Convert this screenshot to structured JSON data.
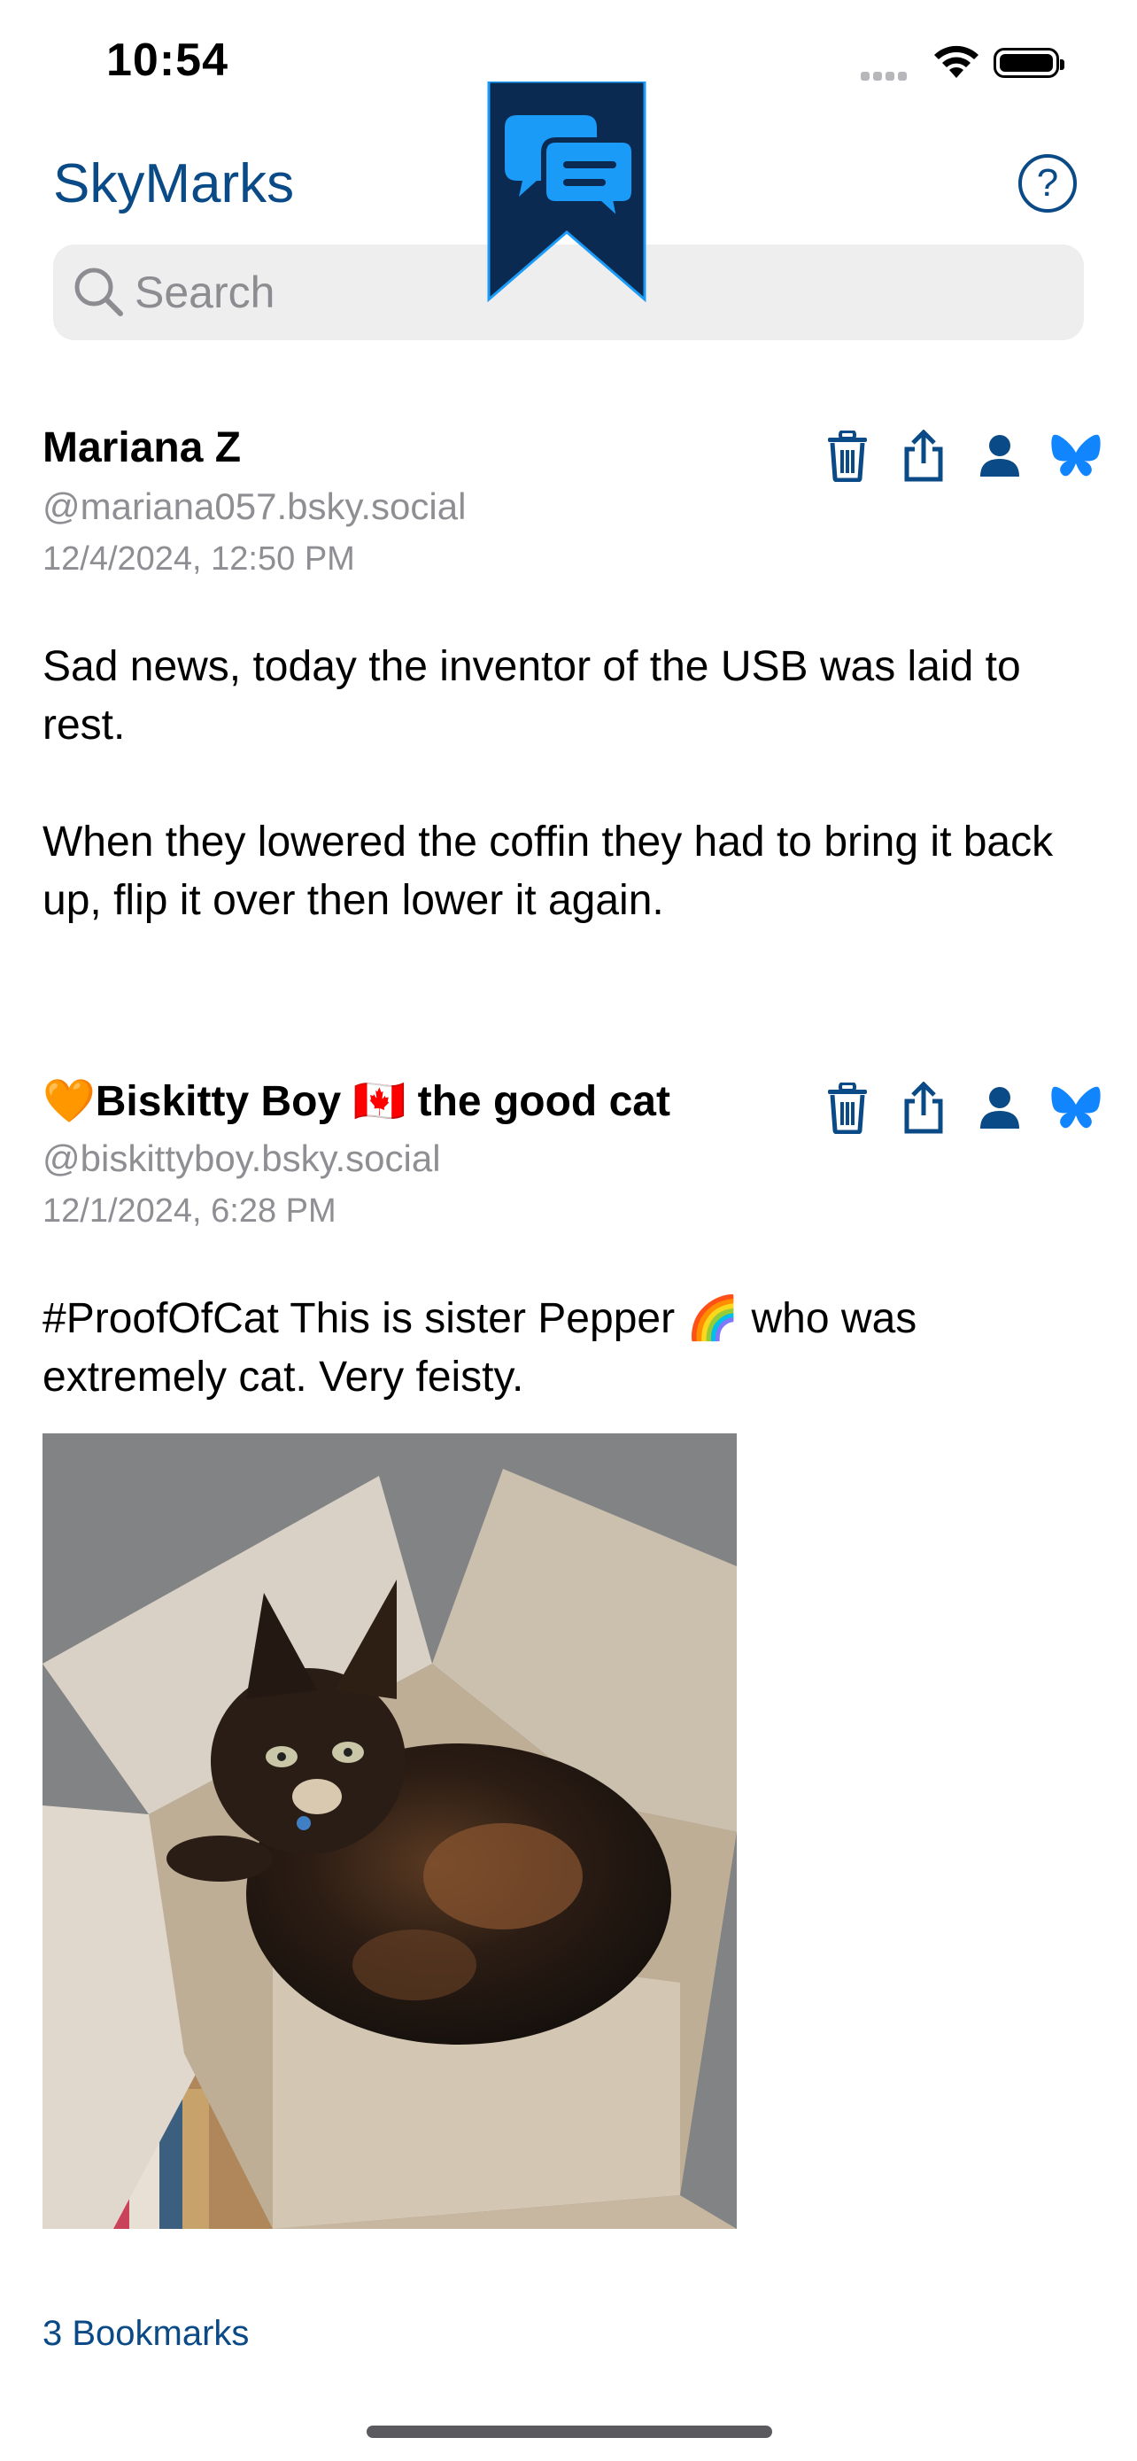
{
  "status": {
    "time": "10:54"
  },
  "nav": {
    "title": "SkyMarks",
    "help_label": "?"
  },
  "search": {
    "placeholder": "Search"
  },
  "posts": [
    {
      "author": "Mariana Z",
      "handle": "@mariana057.bsky.social",
      "date": "12/4/2024, 12:50 PM",
      "text": "Sad news, today the inventor of the USB was laid to rest.\n\nWhen they lowered the coffin they had to bring it back up, flip it over then lower it again."
    },
    {
      "author": "🧡Biskitty Boy 🇨🇦 the good cat",
      "handle": "@biskittyboy.bsky.social",
      "date": "12/1/2024, 6:28 PM",
      "text": "#ProofOfCat This is sister Pepper 🌈 who was extremely cat. Very feisty.",
      "image": "cat-in-box-photo"
    }
  ],
  "icons": [
    "trash-icon",
    "share-icon",
    "profile-icon",
    "butterfly-icon",
    "search-icon",
    "bookmark-logo-icon"
  ],
  "footer": {
    "count_label": "3 Bookmarks"
  },
  "colors": {
    "accent": "#0a4a86",
    "butterfly": "#1185fe",
    "logo_bg": "#0a2a52",
    "logo_bubble": "#1a9bf7"
  }
}
